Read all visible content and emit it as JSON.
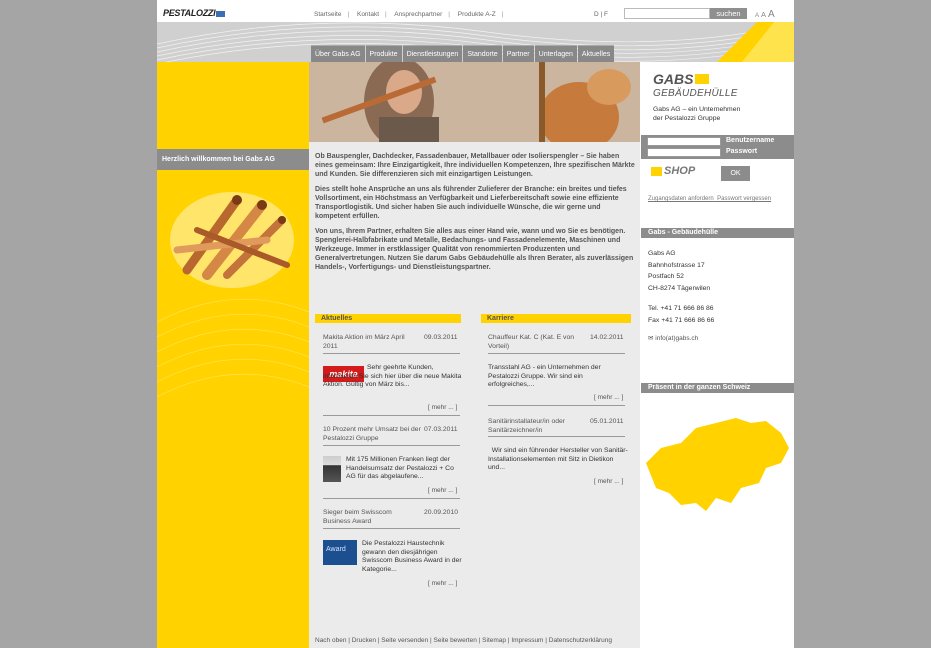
{
  "top": {
    "logo": "PESTALOZZI",
    "links": [
      "Startseite",
      "Kontakt",
      "Ansprechpartner",
      "Produkte A-Z"
    ],
    "lang": "D | F",
    "search_button": "suchen",
    "fontsize": [
      "A",
      "A",
      "A"
    ]
  },
  "nav": [
    "Über Gabs AG",
    "Produkte",
    "Dienstleistungen",
    "Standorte",
    "Partner",
    "Unterlagen",
    "Aktuelles"
  ],
  "welcome": "Herzlich willkommen bei Gabs AG",
  "intro": [
    "Ob Bauspengler, Dachdecker, Fassadenbauer, Metallbauer oder Isolierspengler – Sie haben eines gemeinsam: Ihre Einzigartigkeit, Ihre individuellen Kompetenzen, Ihre spezifischen Märkte und Kunden. Sie differenzieren sich mit einzigartigen Leistungen.",
    "Dies stellt hohe Ansprüche an uns als führender Zulieferer der Branche: ein breites und tiefes Vollsortiment, ein Höchstmass an Verfügbarkeit und Lieferbereitschaft sowie eine effiziente Transportlogistik. Und sicher haben Sie auch individuelle Wünsche, die wir gerne und kompetent erfüllen.",
    "Von uns, Ihrem Partner, erhalten Sie alles aus einer Hand wie, wann und wo Sie es benötigen. Spenglerei-Halbfabrikate und Metalle, Bedachungs- und Fassadenelemente, Maschinen und Werkzeuge. Immer in erstklassiger Qualität von renommierten Produzenten und Generalvertretungen. Nutzen Sie darum Gabs Gebäudehülle als Ihren Berater, als zuverlässigen Handels-, Vorfertigungs- und Dienstleistungspartner."
  ],
  "aktuelles": {
    "title": "Aktuelles",
    "more": "[ mehr ... ]",
    "items": [
      {
        "title": "Makita Aktion im März April 2011",
        "date": "09.03.2011",
        "text": "Sehr geehrte Kunden, informieren Sie sich hier über die neue Makita Aktion. Gültig von März bis..."
      },
      {
        "title": "10 Prozent mehr Umsatz bei der Pestalozzi Gruppe",
        "date": "07.03.2011",
        "text": "Mit 175 Millionen Franken liegt der Handelsumsatz der Pestalozzi + Co AG für das abgelaufene..."
      },
      {
        "title": "Sieger beim Swisscom Business Award",
        "date": "20.09.2010",
        "text": "Die Pestalozzi Haustechnik gewann den diesjährigen Swisscom Business Award in der Kategorie..."
      }
    ],
    "makita_logo": "makita",
    "award_logo": "Award"
  },
  "karriere": {
    "title": "Karriere",
    "more": "[ mehr ... ]",
    "items": [
      {
        "title": "Chauffeur Kat. C (Kat. E von Vorteil)",
        "date": "14.02.2011",
        "text": "Transstahl AG - ein Unternehmen der Pestalozzi Gruppe.   Wir sind ein erfolgreiches,..."
      },
      {
        "title": "Sanitärinstallateur/in oder Sanitärzeichner/in",
        "date": "05.01.2011",
        "text": "  Wir sind ein führender Hersteller von Sanitär-Installationselementen mit Sitz in Dietikon und..."
      }
    ]
  },
  "footer": "Nach oben | Drucken | Seite versenden | Seite bewerten | Sitemap | Impressum | Datenschutzerklärung",
  "right": {
    "logo_line1": "GABS",
    "logo_line2": "GEBÄUDEHÜLLE",
    "tagline1": "Gabs AG – ein Unternehmen",
    "tagline2": "der Pestalozzi Gruppe",
    "username": "Benutzername",
    "password": "Passwort",
    "shop": "SHOP",
    "ok": "OK",
    "link1": "Zugangsdaten anfordern",
    "link2": "Passwort vergessen",
    "contact_head": "Gabs - Gebäudehülle",
    "addr": [
      "Gabs AG",
      "Bahnhofstrasse 17",
      "Postfach 52",
      "CH-8274 Tägerwilen"
    ],
    "tel": "Tel. +41 71 666 86 86",
    "fax": "Fax +41 71 666 86 66",
    "email": "info(at)gabs.ch",
    "map_head": "Präsent in der ganzen Schweiz"
  },
  "colors": {
    "accent": "#ffd200",
    "grey": "#8c8c8c"
  }
}
